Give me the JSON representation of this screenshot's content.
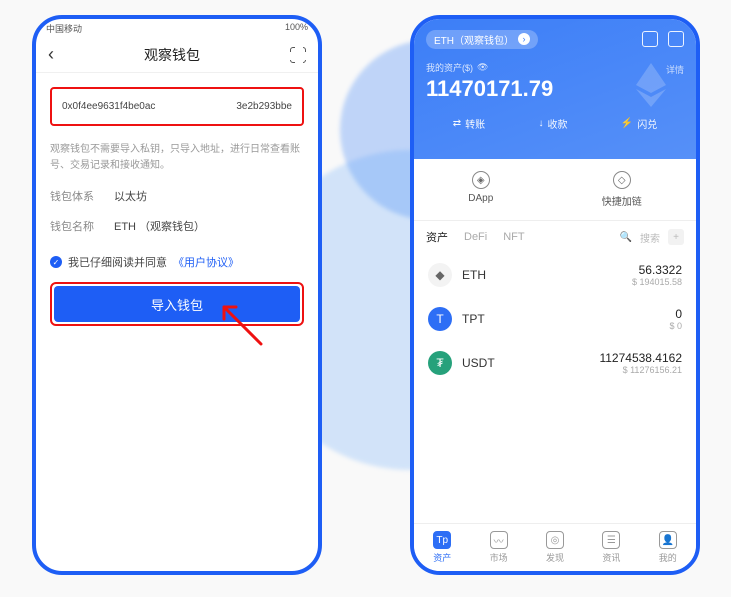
{
  "left": {
    "status_left": "中国移动",
    "status_right": "100%",
    "title": "观察钱包",
    "addr_left": "0x0f4ee9631f4be0ac",
    "addr_right": "3e2b293bbe",
    "desc": "观察钱包不需要导入私钥，只导入地址，进行日常查看账号、交易记录和接收通知。",
    "field_chain_label": "钱包体系",
    "field_chain_value": "以太坊",
    "field_name_label": "钱包名称",
    "field_name_value": "ETH （观察钱包）",
    "agree_prefix": "我已仔细阅读并同意",
    "agree_link": "《用户协议》",
    "import_btn": "导入钱包"
  },
  "right": {
    "pill": "ETH（观察钱包）",
    "sub_label": "我的资产($)",
    "amount": "11470171.79",
    "detail": "详情",
    "actions": {
      "transfer": "转账",
      "receive": "收款",
      "swap": "闪兑"
    },
    "quick": {
      "dapp": "DApp",
      "chain": "快捷加链"
    },
    "tabs": {
      "assets": "资产",
      "defi": "DeFi",
      "nft": "NFT",
      "search": "搜索"
    },
    "assets": [
      {
        "sym": "ETH",
        "amt": "56.3322",
        "fiat": "$ 194015.58"
      },
      {
        "sym": "TPT",
        "amt": "0",
        "fiat": "$ 0"
      },
      {
        "sym": "USDT",
        "amt": "11274538.4162",
        "fiat": "$ 11276156.21"
      }
    ],
    "nav": {
      "assets": "资产",
      "market": "市场",
      "discover": "发现",
      "news": "资讯",
      "me": "我的"
    }
  }
}
